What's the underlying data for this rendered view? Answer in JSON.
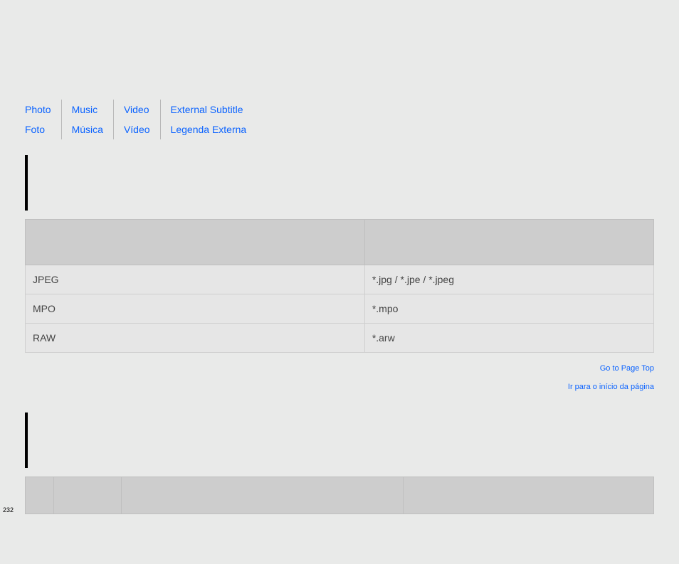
{
  "nav": {
    "row1": [
      "Photo",
      "Music",
      "Video",
      "External Subtitle"
    ],
    "row2": [
      "Foto",
      "Música",
      "Vídeo",
      "Legenda Externa"
    ]
  },
  "table1": {
    "headers": [
      "",
      ""
    ],
    "rows": [
      [
        "JPEG",
        "*.jpg / *.jpe / *.jpeg"
      ],
      [
        "MPO",
        "*.mpo"
      ],
      [
        "RAW",
        "*.arw"
      ]
    ]
  },
  "pageTop": {
    "en": "Go to Page Top",
    "pt": "Ir para o início da página"
  },
  "table2": {
    "headers": [
      "",
      "",
      "",
      ""
    ]
  },
  "pageNumber": "232"
}
